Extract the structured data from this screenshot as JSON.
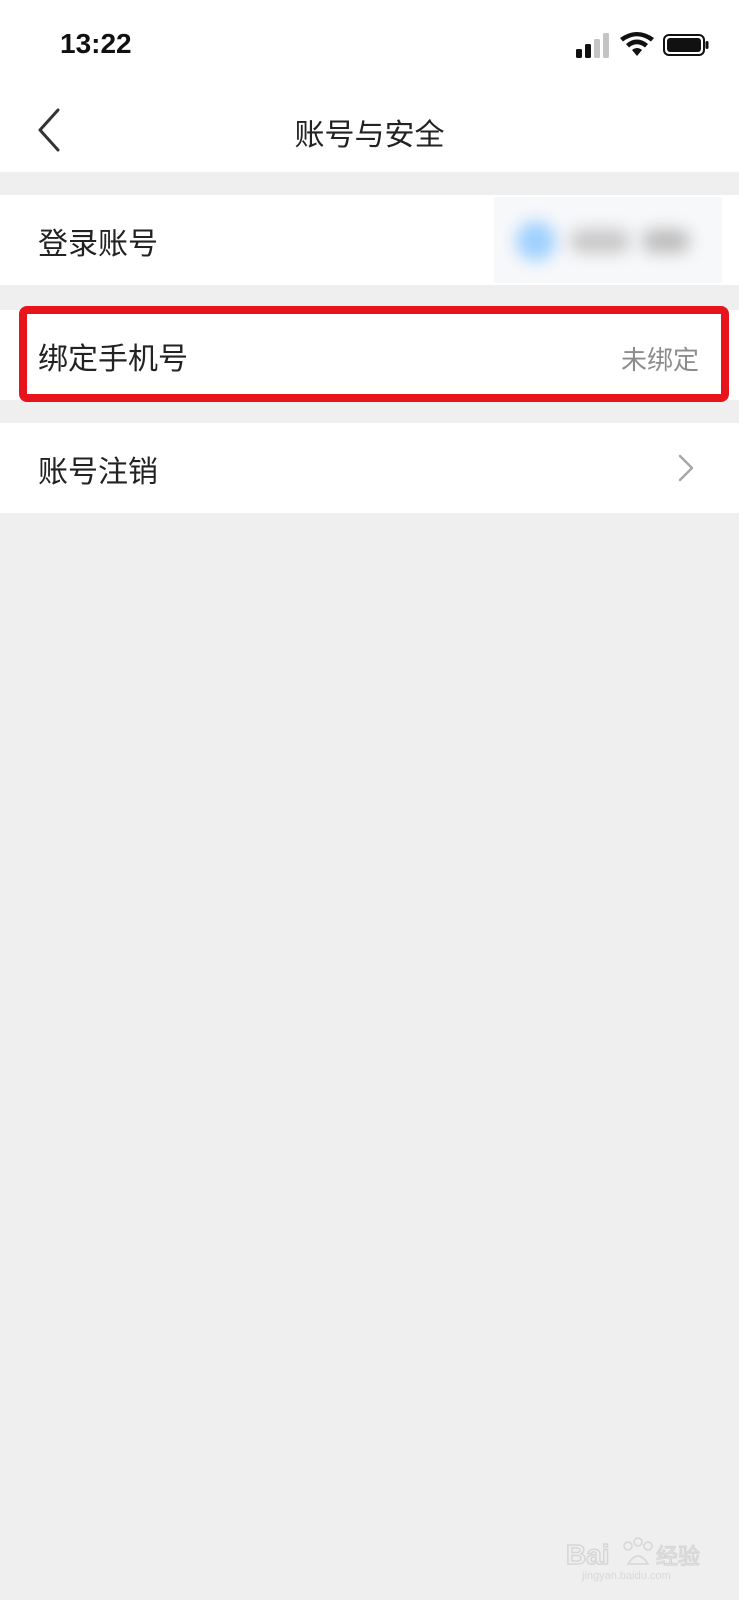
{
  "status_bar": {
    "time": "13:22",
    "icons": [
      "signal-icon",
      "wifi-icon",
      "battery-icon"
    ]
  },
  "nav": {
    "title": "账号与安全",
    "back_icon": "back-chevron-icon"
  },
  "rows": [
    {
      "label": "登录账号",
      "value": ""
    },
    {
      "label": "绑定手机号",
      "value": "未绑定"
    },
    {
      "label": "账号注销",
      "value": "",
      "icon": "chevron-right-icon"
    }
  ],
  "highlight": {
    "color": "#e8141c",
    "target": "绑定手机号"
  },
  "watermark": {
    "brand": "Baidu 经验",
    "url": "jingyan.baidu.com"
  }
}
